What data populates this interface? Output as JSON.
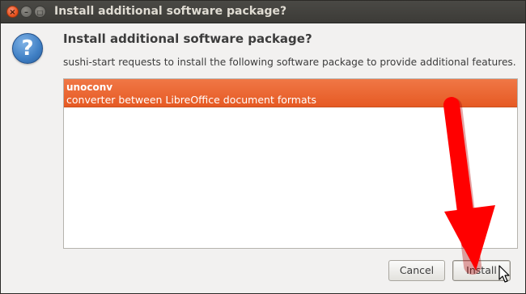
{
  "window": {
    "title": "Install additional software package?",
    "controls": {
      "close": "×",
      "minimize": "–",
      "maximize": "□"
    }
  },
  "dialog": {
    "icon": "question-icon",
    "icon_glyph": "?",
    "heading": "Install additional software package?",
    "description": "sushi-start requests to install the following software package to provide additional features."
  },
  "packages": [
    {
      "name": "unoconv",
      "summary": "converter between LibreOffice document formats",
      "selected": true
    }
  ],
  "buttons": {
    "cancel_label": "Cancel",
    "install_label": "Install"
  },
  "colors": {
    "titlebar": "#3c3b37",
    "selection": "#e95420",
    "annotation_arrow": "#ff0000",
    "question_icon": "#3f7fc4"
  }
}
